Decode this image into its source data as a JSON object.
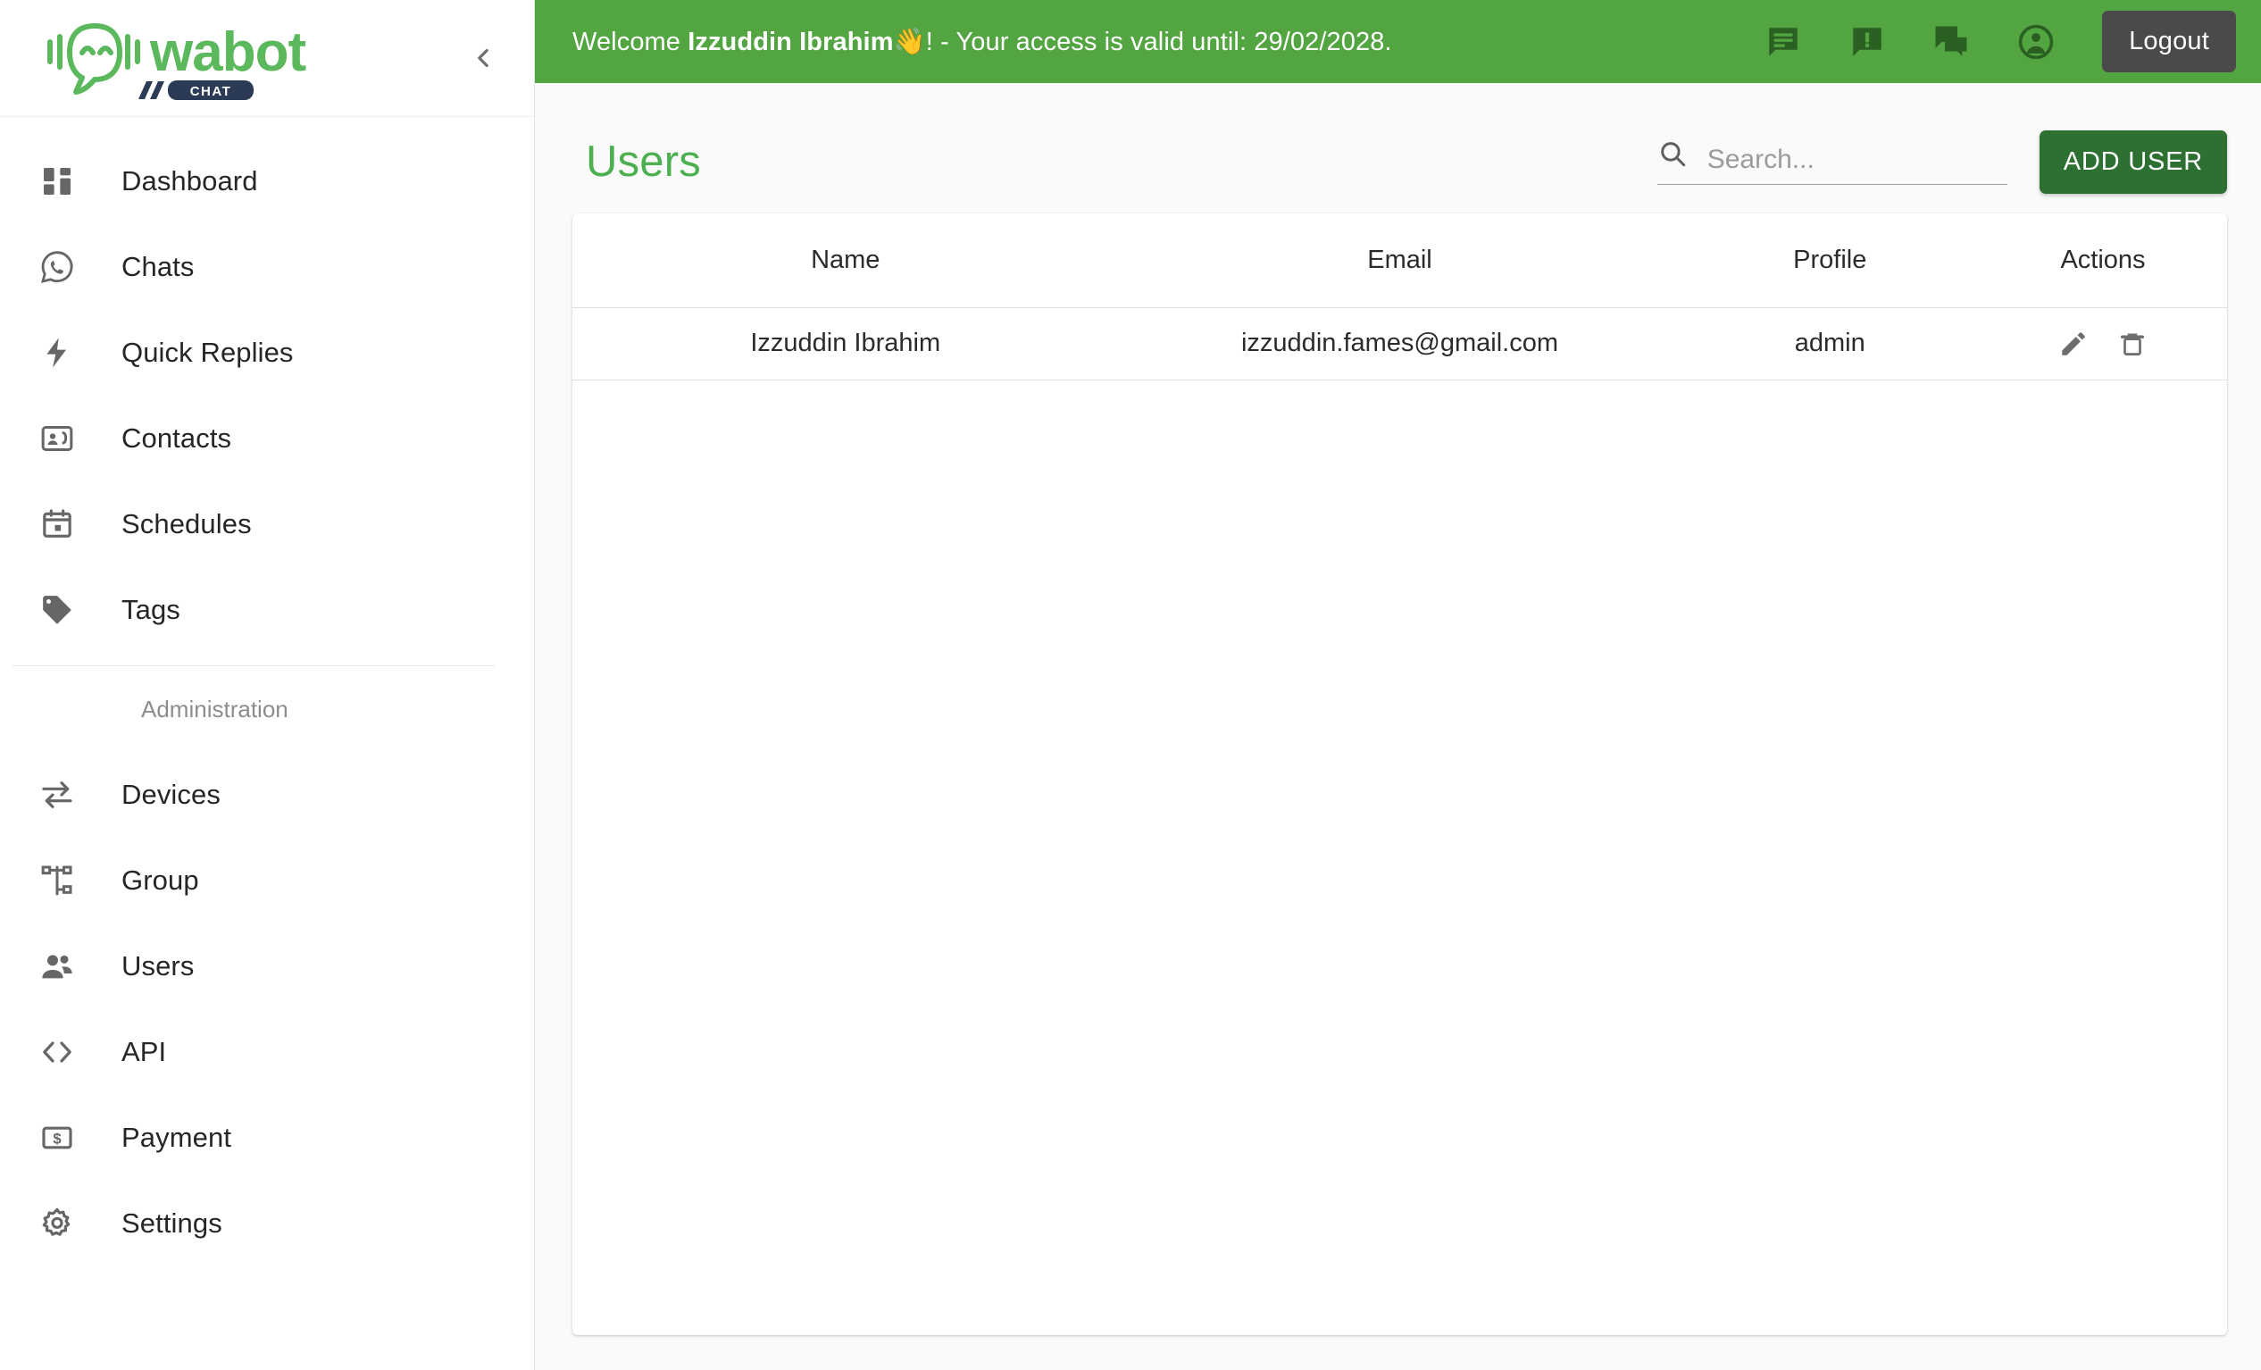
{
  "brand": {
    "name": "wabot",
    "badge": "CHAT",
    "logo_green": "#5cb85c",
    "badge_navy": "#2b3a55"
  },
  "sidebar": {
    "collapse_icon": "chevron-left-icon",
    "items": [
      {
        "label": "Dashboard",
        "icon": "dashboard-grid-icon"
      },
      {
        "label": "Chats",
        "icon": "whatsapp-icon"
      },
      {
        "label": "Quick Replies",
        "icon": "bolt-icon"
      },
      {
        "label": "Contacts",
        "icon": "contact-card-icon"
      },
      {
        "label": "Schedules",
        "icon": "calendar-icon"
      },
      {
        "label": "Tags",
        "icon": "tag-icon"
      }
    ],
    "section_label": "Administration",
    "admin_items": [
      {
        "label": "Devices",
        "icon": "sync-arrows-icon"
      },
      {
        "label": "Group",
        "icon": "org-tree-icon"
      },
      {
        "label": "Users",
        "icon": "people-icon"
      },
      {
        "label": "API",
        "icon": "code-brackets-icon"
      },
      {
        "label": "Payment",
        "icon": "dollar-card-icon"
      },
      {
        "label": "Settings",
        "icon": "gear-icon"
      }
    ]
  },
  "topbar": {
    "welcome_prefix": "Welcome ",
    "user_name": "Izzuddin Ibrahim",
    "wave_emoji": "👋",
    "welcome_suffix": "! - Your access is valid until: 29/02/2028.",
    "background_color": "#53a542",
    "icons": [
      {
        "name": "feed-message-icon"
      },
      {
        "name": "alert-message-icon"
      },
      {
        "name": "forum-icon"
      },
      {
        "name": "account-circle-icon"
      }
    ],
    "logout_label": "Logout"
  },
  "page": {
    "title": "Users",
    "title_color": "#4caf50"
  },
  "search": {
    "icon": "search-icon",
    "placeholder": "Search...",
    "value": ""
  },
  "actions": {
    "add_user_label": "ADD USER",
    "add_user_color": "#2e7031"
  },
  "table": {
    "columns": [
      "Name",
      "Email",
      "Profile",
      "Actions"
    ],
    "rows": [
      {
        "name": "Izzuddin Ibrahim",
        "email": "izzuddin.fames@gmail.com",
        "profile": "admin",
        "edit_icon": "pencil-icon",
        "delete_icon": "trash-icon"
      }
    ]
  }
}
